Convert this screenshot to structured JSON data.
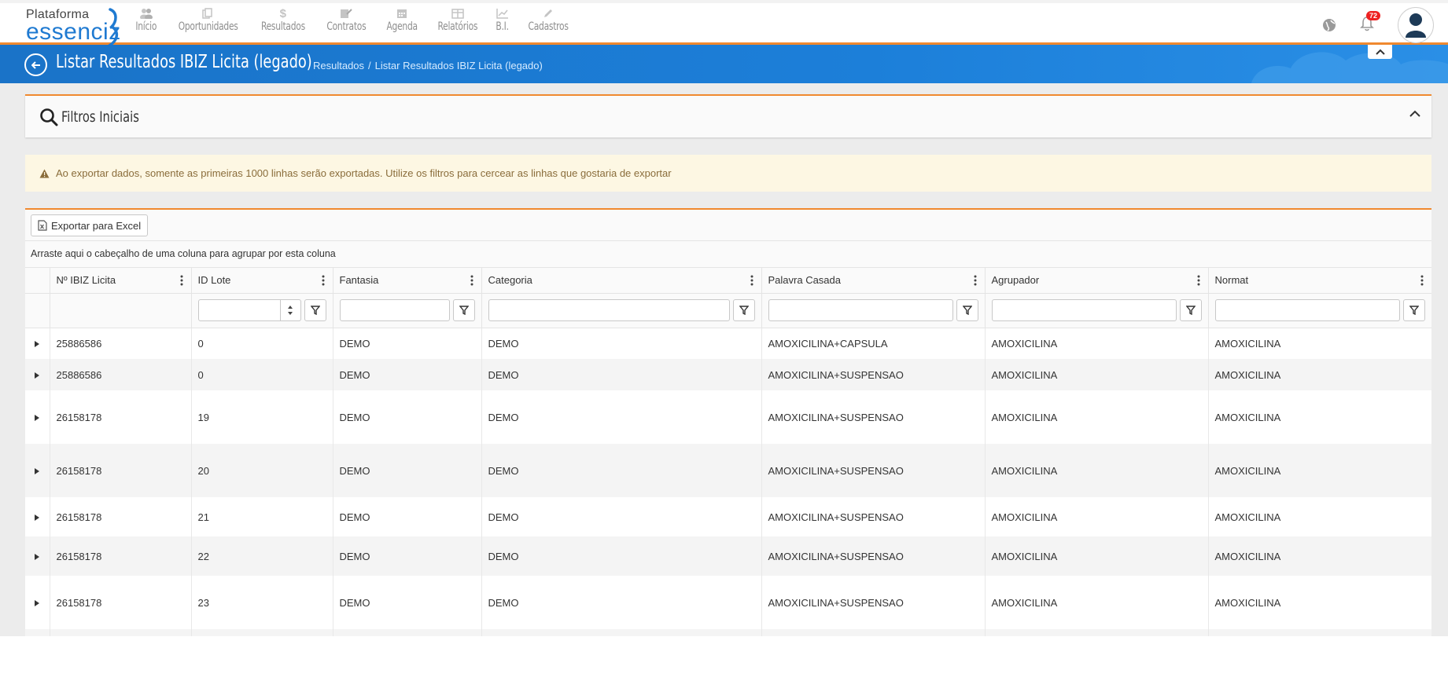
{
  "logo": {
    "line1": "Plataforma",
    "line2": "essenciz",
    "brand_color": "#1f7ad1"
  },
  "nav": [
    {
      "label": "Início",
      "icon": "users-icon"
    },
    {
      "label": "Oportunidades",
      "icon": "copy-icon"
    },
    {
      "label": "Resultados",
      "icon": "dollar-icon"
    },
    {
      "label": "Contratos",
      "icon": "document-pen-icon"
    },
    {
      "label": "Agenda",
      "icon": "calendar-icon"
    },
    {
      "label": "Relatórios",
      "icon": "table-icon"
    },
    {
      "label": "B.I.",
      "icon": "line-chart-icon"
    },
    {
      "label": "Cadastros",
      "icon": "pencil-icon"
    }
  ],
  "notifications": {
    "count": "72"
  },
  "header": {
    "title": "Listar Resultados IBIZ Licita (legado)",
    "breadcrumb": [
      "Resultados",
      "Listar Resultados IBIZ Licita (legado)"
    ]
  },
  "filter_panel": {
    "title": "Filtros Iniciais"
  },
  "warning": {
    "text": "Ao exportar dados, somente as primeiras 1000 linhas serão exportadas. Utilize os filtros para cercear as linhas que gostaria de exportar"
  },
  "grid": {
    "export_label": "Exportar para Excel",
    "group_hint": "Arraste aqui o cabeçalho de uma coluna para agrupar por esta coluna",
    "columns": [
      "Nº IBIZ Licita",
      "ID Lote",
      "Fantasia",
      "Categoria",
      "Palavra Casada",
      "Agrupador",
      "Normat"
    ],
    "rows": [
      [
        "25886586",
        "0",
        "DEMO",
        "DEMO",
        "AMOXICILINA+CAPSULA",
        "AMOXICILINA",
        "AMOXICILINA"
      ],
      [
        "25886586",
        "0",
        "DEMO",
        "DEMO",
        "AMOXICILINA+SUSPENSAO",
        "AMOXICILINA",
        "AMOXICILINA"
      ],
      [
        "26158178",
        "19",
        "DEMO",
        "DEMO",
        "AMOXICILINA+SUSPENSAO",
        "AMOXICILINA",
        "AMOXICILINA"
      ],
      [
        "26158178",
        "20",
        "DEMO",
        "DEMO",
        "AMOXICILINA+SUSPENSAO",
        "AMOXICILINA",
        "AMOXICILINA"
      ],
      [
        "26158178",
        "21",
        "DEMO",
        "DEMO",
        "AMOXICILINA+SUSPENSAO",
        "AMOXICILINA",
        "AMOXICILINA"
      ],
      [
        "26158178",
        "22",
        "DEMO",
        "DEMO",
        "AMOXICILINA+SUSPENSAO",
        "AMOXICILINA",
        "AMOXICILINA"
      ],
      [
        "26158178",
        "23",
        "DEMO",
        "DEMO",
        "AMOXICILINA+SUSPENSAO",
        "AMOXICILINA",
        "AMOXICILINA"
      ]
    ]
  },
  "colors": {
    "accent_orange": "#f0892f",
    "title_blue": "#1c7fd9",
    "warning_bg": "#fdf7e3",
    "warning_text": "#8a6d3b",
    "badge_red": "#ee2222"
  }
}
